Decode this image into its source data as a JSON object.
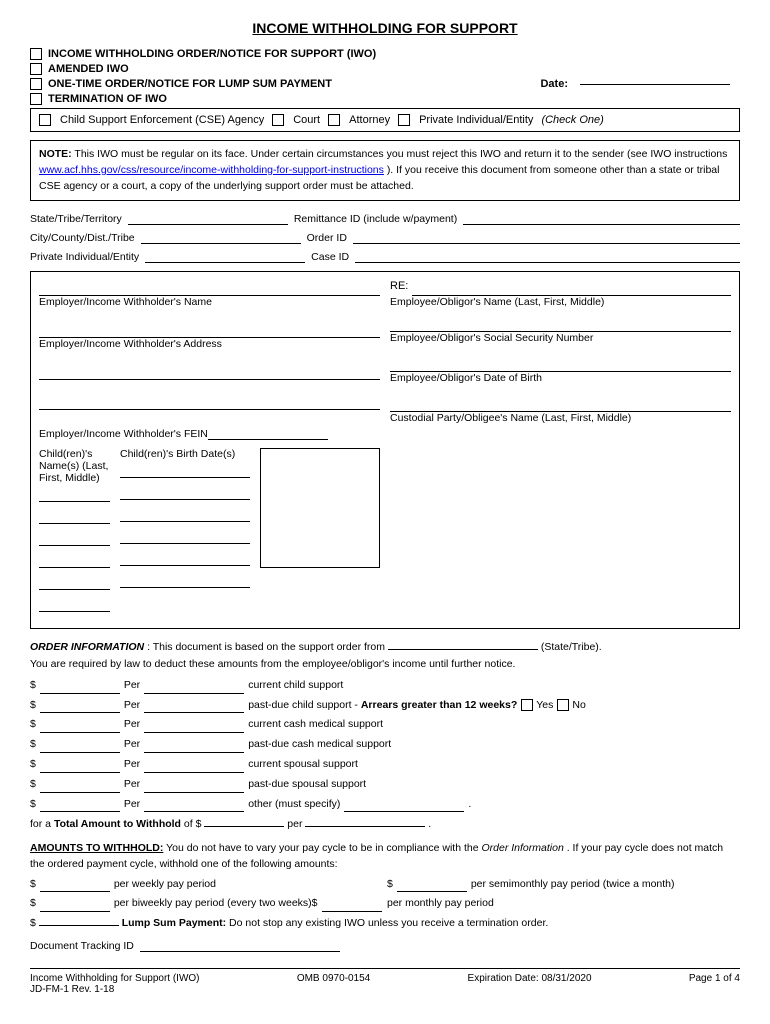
{
  "title": "INCOME WITHHOLDING FOR SUPPORT",
  "checkboxes": {
    "iwo": "INCOME WITHHOLDING ORDER/NOTICE FOR SUPPORT (IWO)",
    "amended": "AMENDED IWO",
    "one_time": "ONE-TIME ORDER/NOTICE FOR LUMP SUM PAYMENT",
    "termination": "TERMINATION OF IWO"
  },
  "date_label": "Date:",
  "check_one_row": {
    "cse": "Child Support Enforcement (CSE) Agency",
    "court": "Court",
    "attorney": "Attorney",
    "private": "Private Individual/Entity",
    "check_one": "(Check One)"
  },
  "note": {
    "label": "NOTE:",
    "text": "  This IWO must be regular on its face.  Under certain circumstances you must reject this IWO and return it to the sender (see IWO instructions ",
    "link": "www.acf.hhs.gov/css/resource/income-withholding-for-support-instructions",
    "text2": "). If you receive this document from someone other than a state or tribal CSE agency or a court, a copy of the underlying support order must be attached."
  },
  "state_fields": {
    "state_tribe_territory": "State/Tribe/Territory",
    "remittance_id": "Remittance ID (include w/payment)",
    "city_county": "City/County/Dist./Tribe",
    "order_id": "Order ID",
    "private_individual": "Private Individual/Entity",
    "case_id": "Case ID"
  },
  "employer_section": {
    "re_label": "RE:",
    "employer_name_label": "Employer/Income Withholder's Name",
    "employer_address_label": "Employer/Income Withholder's Address",
    "employer_fein_label": "Employer/Income Withholder's FEIN",
    "employee_name_label": "Employee/Obligor's Name (Last, First, Middle)",
    "employee_ssn_label": "Employee/Obligor's Social Security Number",
    "employee_dob_label": "Employee/Obligor's Date of Birth",
    "custodial_label": "Custodial Party/Obligee's Name (Last, First, Middle)",
    "children_names_label": "Child(ren)'s Name(s) (Last, First, Middle)",
    "children_birth_label": "Child(ren)'s Birth Date(s)"
  },
  "order_info": {
    "title": "ORDER INFORMATION",
    "text1": ": This document is based on the support order from",
    "text2": "(State/Tribe).",
    "text3": "You are required by law to deduct these amounts from the employee/obligor's income until further notice.",
    "support_rows": [
      {
        "label": "current child support"
      },
      {
        "label": "past-due child support - ",
        "arrears": "Arrears greater than 12 weeks?",
        "yes_no": true
      },
      {
        "label": "current cash medical support"
      },
      {
        "label": "past-due cash medical support"
      },
      {
        "label": "current spousal support"
      },
      {
        "label": "past-due spousal support"
      },
      {
        "label": "other (must specify)"
      }
    ],
    "total_label": "for a",
    "total_bold": "Total Amount to Withhold",
    "total_of": "of $",
    "per_label": "per"
  },
  "amounts": {
    "title": "AMOUNTS TO WITHHOLD:",
    "text": " You do not have to vary your pay cycle to be in compliance with the ",
    "order_info_italic": "Order Information",
    "text2": ".  If your pay cycle does not match the ordered payment cycle, withhold one of the following amounts:",
    "pay_periods": [
      {
        "label": "per weekly pay period"
      },
      {
        "label": "per semimonthly pay period (twice a month)"
      },
      {
        "label": "per biweekly pay period (every two weeks)"
      },
      {
        "label": "per monthly pay period"
      }
    ],
    "lump_sum": "Lump Sum Payment:",
    "lump_sum_text": "Do not stop any existing IWO unless you receive a termination order."
  },
  "tracking": {
    "label": "Document Tracking ID"
  },
  "footer": {
    "form_name": "Income Withholding for Support (IWO)",
    "omb": "OMB 0970-0154",
    "expiration": "Expiration Date: 08/31/2020",
    "page": "Page 1 of 4",
    "revision": "JD-FM-1  Rev. 1-18"
  }
}
